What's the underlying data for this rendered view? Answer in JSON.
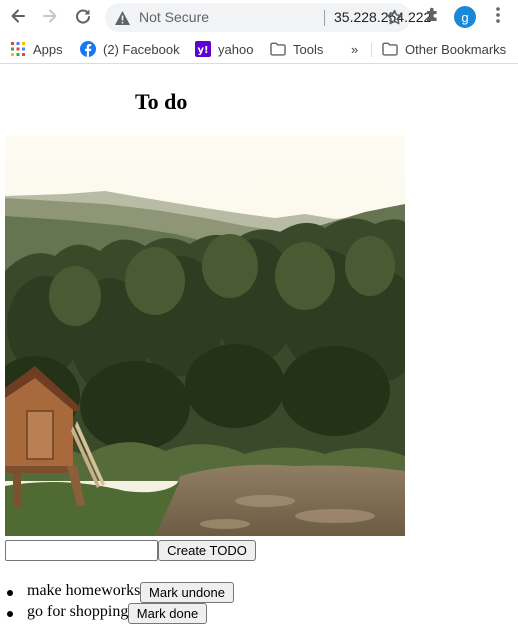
{
  "browser": {
    "security_status": "Not Secure",
    "url": "35.228.254.222",
    "profile_initial": "g",
    "icons": {
      "back": "back-arrow-icon",
      "forward": "forward-arrow-icon",
      "reload": "reload-icon",
      "warning": "warning-icon",
      "star": "star-icon",
      "extensions": "puzzle-icon",
      "menu": "kebab-menu-icon"
    },
    "accent_color": "#1a88d6"
  },
  "bookmarks": {
    "items": [
      {
        "label": "Apps",
        "icon": "apps-grid-icon"
      },
      {
        "label": "(2) Facebook",
        "icon": "facebook-icon"
      },
      {
        "label": "yahoo",
        "icon": "yahoo-icon"
      },
      {
        "label": "Tools",
        "icon": "folder-icon"
      }
    ],
    "overflow": "»",
    "other": {
      "label": "Other Bookmarks",
      "icon": "folder-icon"
    }
  },
  "page": {
    "title": "To do",
    "image": "landscape-photo",
    "input": {
      "value": "",
      "placeholder": ""
    },
    "create_button": "Create TODO",
    "todos": [
      {
        "text": "make homeworks",
        "button": "Mark undone"
      },
      {
        "text": "go for shopping",
        "button": "Mark done"
      }
    ]
  }
}
